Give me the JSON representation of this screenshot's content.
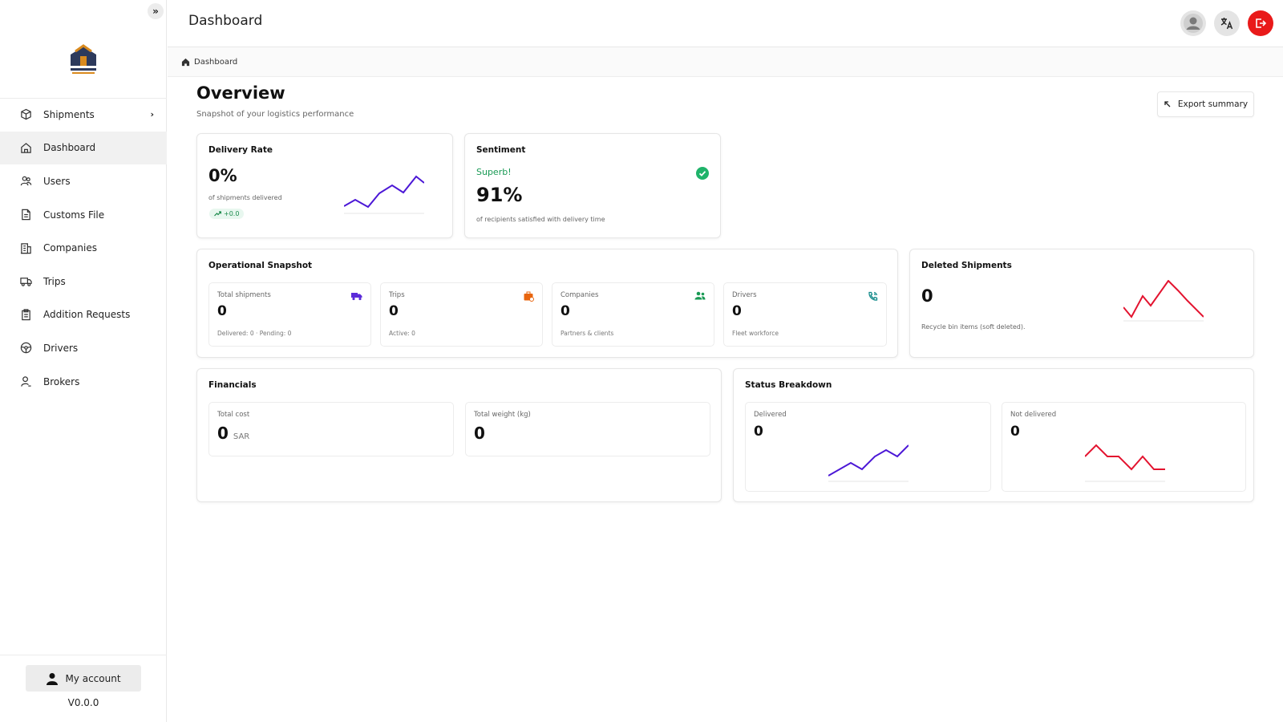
{
  "sidebar": {
    "collapse_glyph": "»",
    "items": [
      {
        "label": "Shipments",
        "icon": "box-icon",
        "has_children": true
      },
      {
        "label": "Dashboard",
        "icon": "home-icon",
        "active": true
      },
      {
        "label": "Users",
        "icon": "users-icon"
      },
      {
        "label": "Customs File",
        "icon": "file-icon"
      },
      {
        "label": "Companies",
        "icon": "building-icon"
      },
      {
        "label": "Trips",
        "icon": "truck-icon"
      },
      {
        "label": "Addition Requests",
        "icon": "clipboard-icon"
      },
      {
        "label": "Drivers",
        "icon": "steering-wheel-icon"
      },
      {
        "label": "Brokers",
        "icon": "broker-icon"
      }
    ],
    "my_account_label": "My account",
    "version": "V0.0.0"
  },
  "header": {
    "title": "Dashboard",
    "actions": [
      "avatar",
      "translate-icon",
      "logout-icon"
    ]
  },
  "breadcrumb": {
    "label": "Dashboard"
  },
  "overview": {
    "title": "Overview",
    "subtitle": "Snapshot of your logistics performance",
    "export_label": "Export summary"
  },
  "delivery_rate": {
    "title": "Delivery Rate",
    "value": "0%",
    "note": "of shipments delivered",
    "trend": "+0.0"
  },
  "sentiment": {
    "title": "Sentiment",
    "status": "Superb!",
    "value": "91%",
    "note": "of recipients satisfied with delivery time"
  },
  "operational": {
    "title": "Operational Snapshot",
    "tiles": [
      {
        "label": "Total shipments",
        "value": "0",
        "note": "Delivered: 0 · Pending: 0",
        "icon": "truck-icon",
        "color": "#5b2bd9"
      },
      {
        "label": "Trips",
        "value": "0",
        "note": "Active: 0",
        "icon": "briefcase-icon",
        "color": "#e8650e"
      },
      {
        "label": "Companies",
        "value": "0",
        "note": "Partners & clients",
        "icon": "people-icon",
        "color": "#1a9a55"
      },
      {
        "label": "Drivers",
        "value": "0",
        "note": "Fleet workforce",
        "icon": "phone-icon",
        "color": "#138a8a"
      }
    ]
  },
  "deleted": {
    "title": "Deleted Shipments",
    "value": "0",
    "note": "Recycle bin items (soft deleted)."
  },
  "financials": {
    "title": "Financials",
    "total_cost_label": "Total cost",
    "total_cost_value": "0",
    "currency": "SAR",
    "total_weight_label": "Total weight (kg)",
    "total_weight_value": "0"
  },
  "status_breakdown": {
    "title": "Status Breakdown",
    "delivered_label": "Delivered",
    "delivered_value": "0",
    "not_delivered_label": "Not delivered",
    "not_delivered_value": "0"
  },
  "colors": {
    "accent_purple": "#4b17d6",
    "accent_red": "#e3132f",
    "success_green": "#1a9a55",
    "logout_red": "#e91a1a"
  }
}
